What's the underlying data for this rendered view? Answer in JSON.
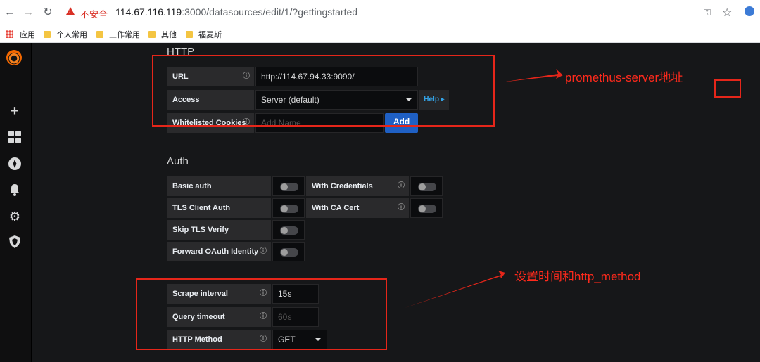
{
  "browser": {
    "security_label": "不安全",
    "url_host": "114.67.116.119",
    "url_rest": ":3000/datasources/edit/1/?gettingstarted",
    "bookmarks": [
      "应用",
      "个人常用",
      "工作常用",
      "其他",
      "福麦斯"
    ]
  },
  "sidemenu": {
    "icons": [
      "grafana-logo",
      "plus-icon",
      "dashboards-icon",
      "explore-icon",
      "alert-bell-icon",
      "gear-icon",
      "shield-icon"
    ]
  },
  "http": {
    "title": "HTTP",
    "url_label": "URL",
    "url_value": "http://114.67.94.33:9090/",
    "access_label": "Access",
    "access_value": "Server (default)",
    "help_label": "Help ▸",
    "cookies_label": "Whitelisted Cookies",
    "cookies_placeholder": "Add Name",
    "add_label": "Add"
  },
  "auth": {
    "title": "Auth",
    "basic_auth": "Basic auth",
    "with_credentials": "With Credentials",
    "tls_client_auth": "TLS Client Auth",
    "with_ca_cert": "With CA Cert",
    "skip_tls_verify": "Skip TLS Verify",
    "forward_oauth": "Forward OAuth Identity"
  },
  "prom": {
    "scrape_label": "Scrape interval",
    "scrape_value": "15s",
    "timeout_label": "Query timeout",
    "timeout_placeholder": "60s",
    "method_label": "HTTP Method",
    "method_value": "GET"
  },
  "annotations": {
    "server_note": "promethus-server地址",
    "method_note": "设置时间和http_method",
    "color": "#e5261a"
  }
}
